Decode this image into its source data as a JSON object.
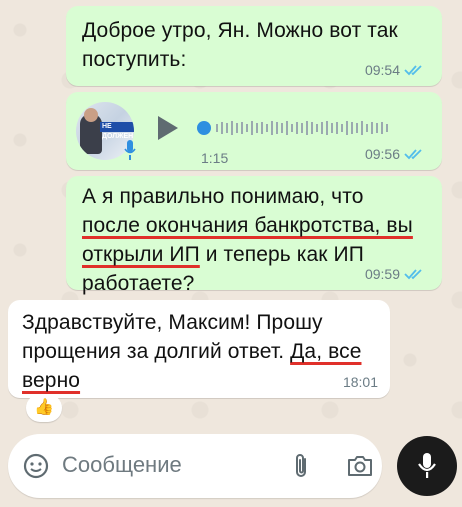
{
  "messages": [
    {
      "direction": "out",
      "text_lines": [
        "Доброе утро, Ян. Можно вот так",
        "поступить:"
      ],
      "time": "09:54",
      "read": true
    },
    {
      "direction": "out",
      "type": "voice",
      "duration": "1:15",
      "time": "09:56",
      "read": true,
      "avatar_banner_text": "НЕ ДОЛЖЕН"
    },
    {
      "direction": "out",
      "parts": {
        "l1": "А я правильно понимаю, что",
        "l2": "после окончания банкротства, вы",
        "l3a": "открыли ИП",
        "l3b": " и теперь как ИП",
        "l4": "работаете?"
      },
      "time": "09:59",
      "read": true
    },
    {
      "direction": "in",
      "parts": {
        "l1": "Здравствуйте, Максим! Прошу",
        "l2a": "прощения за долгий ответ. ",
        "l2b": "Да, все",
        "l3": "верно"
      },
      "time": "18:01",
      "reaction": "👍"
    }
  ],
  "composer": {
    "placeholder": "Сообщение"
  },
  "icons": [
    "emoji-icon",
    "paperclip-icon",
    "camera-icon",
    "microphone-icon",
    "play-icon",
    "double-check-icon"
  ],
  "colors": {
    "outgoing": "#d9fdd3",
    "incoming": "#ffffff",
    "read_ticks": "#53bdeb",
    "annotation": "#e0302a"
  }
}
